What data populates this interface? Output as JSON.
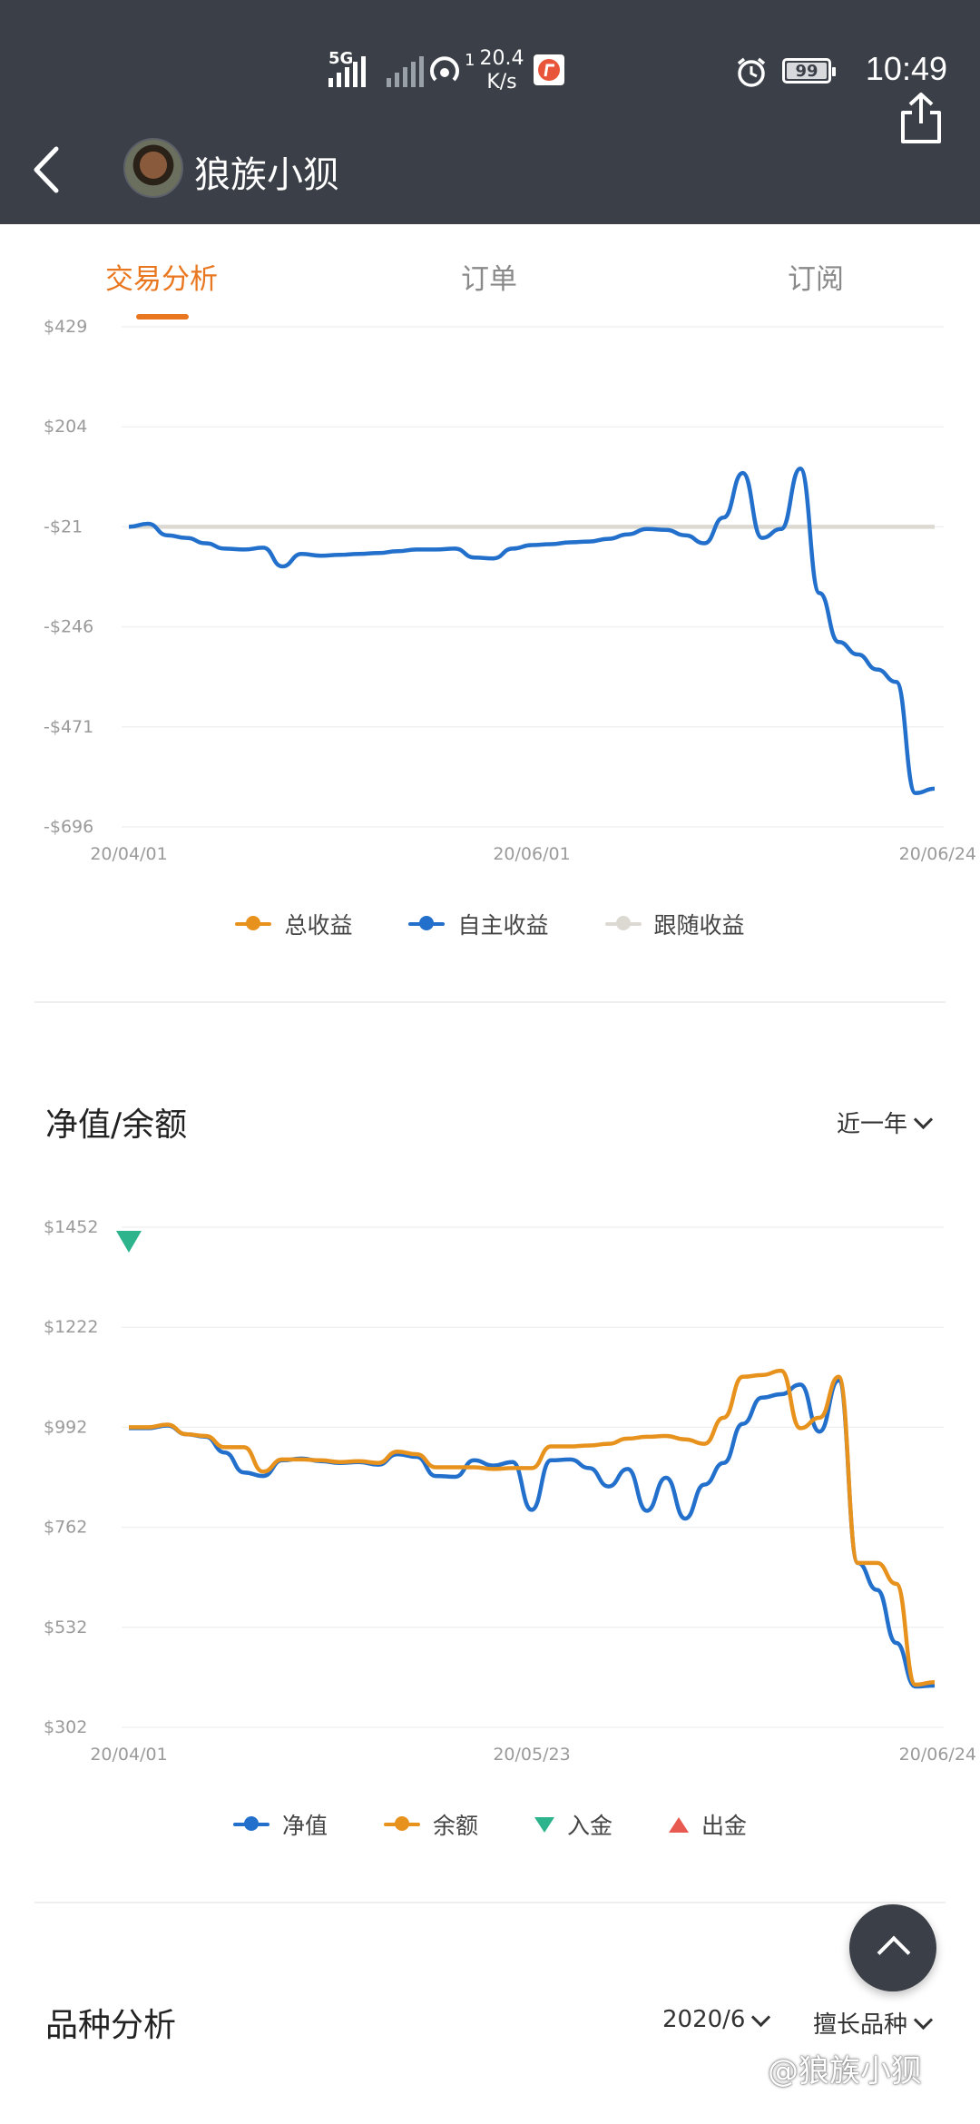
{
  "status_bar": {
    "network": "5G",
    "speed_value": "20.4",
    "speed_unit": "K/s",
    "hotspot_badge": "1",
    "battery": "99",
    "time": "10:49"
  },
  "header": {
    "username": "狼族小狈",
    "icons": [
      "back-arrow-icon",
      "avatar",
      "share-icon"
    ]
  },
  "tabs": [
    {
      "label": "交易分析",
      "active": true
    },
    {
      "label": "订单",
      "active": false
    },
    {
      "label": "订阅",
      "active": false
    }
  ],
  "colors": {
    "header_bg": "#3b3f47",
    "accent": "#e9771f",
    "blue": "#2270cc",
    "orange": "#e8921e",
    "grey": "#dcd9d2",
    "teal": "#2db48c",
    "red": "#e85a4f"
  },
  "chart_data": [
    {
      "type": "line",
      "ylim": [
        -696,
        429
      ],
      "yticks": [
        "$429",
        "$204",
        "-$21",
        "-$246",
        "-$471",
        "-$696"
      ],
      "xticks": [
        "20/04/01",
        "20/06/01",
        "20/06/24"
      ],
      "x": [
        "2020-04-01",
        "2020-04-03",
        "2020-04-05",
        "2020-04-07",
        "2020-04-09",
        "2020-04-11",
        "2020-04-13",
        "2020-04-15",
        "2020-04-17",
        "2020-04-19",
        "2020-04-21",
        "2020-04-23",
        "2020-04-25",
        "2020-04-27",
        "2020-04-29",
        "2020-05-01",
        "2020-05-03",
        "2020-05-05",
        "2020-05-07",
        "2020-05-09",
        "2020-05-11",
        "2020-05-13",
        "2020-05-15",
        "2020-05-17",
        "2020-05-19",
        "2020-05-21",
        "2020-05-23",
        "2020-05-25",
        "2020-05-27",
        "2020-05-29",
        "2020-05-31",
        "2020-06-02",
        "2020-06-04",
        "2020-06-06",
        "2020-06-08",
        "2020-06-10",
        "2020-06-12",
        "2020-06-14",
        "2020-06-16",
        "2020-06-18",
        "2020-06-20",
        "2020-06-22",
        "2020-06-24"
      ],
      "series": [
        {
          "name": "总收益",
          "color": "#e8921e",
          "values": []
        },
        {
          "name": "自主收益",
          "color": "#2270cc",
          "values": [
            -21,
            -14,
            -40,
            -46,
            -58,
            -70,
            -72,
            -68,
            -110,
            -82,
            -86,
            -84,
            -82,
            -80,
            -76,
            -72,
            -72,
            -70,
            -90,
            -92,
            -70,
            -62,
            -60,
            -56,
            -54,
            -48,
            -38,
            -26,
            -28,
            -40,
            -58,
            0,
            100,
            -46,
            -26,
            110,
            -170,
            -280,
            -308,
            -342,
            -370,
            -620,
            -610
          ]
        },
        {
          "name": "跟随收益",
          "color": "#dcd9d2",
          "values": [
            -21,
            -21,
            -21,
            -21,
            -21,
            -21,
            -21,
            -21,
            -21,
            -21,
            -21,
            -21,
            -21,
            -21,
            -21,
            -21,
            -21,
            -21,
            -21,
            -21,
            -21,
            -21,
            -21,
            -21,
            -21,
            -21,
            -21,
            -21,
            -21,
            -21,
            -21,
            -21,
            -21,
            -21,
            -21,
            -21,
            -21,
            -21,
            -21,
            -21,
            -21,
            -21,
            -21
          ]
        }
      ]
    },
    {
      "type": "line",
      "ylim": [
        302,
        1452
      ],
      "yticks": [
        "$1452",
        "$1222",
        "$992",
        "$762",
        "$532",
        "$302"
      ],
      "xticks": [
        "20/04/01",
        "20/05/23",
        "20/06/24"
      ],
      "x": [
        "2020-04-01",
        "2020-04-03",
        "2020-04-05",
        "2020-04-07",
        "2020-04-09",
        "2020-04-11",
        "2020-04-13",
        "2020-04-15",
        "2020-04-17",
        "2020-04-19",
        "2020-04-21",
        "2020-04-23",
        "2020-04-25",
        "2020-04-27",
        "2020-04-29",
        "2020-05-01",
        "2020-05-03",
        "2020-05-05",
        "2020-05-07",
        "2020-05-09",
        "2020-05-11",
        "2020-05-13",
        "2020-05-15",
        "2020-05-17",
        "2020-05-19",
        "2020-05-21",
        "2020-05-23",
        "2020-05-25",
        "2020-05-27",
        "2020-05-29",
        "2020-05-31",
        "2020-06-02",
        "2020-06-04",
        "2020-06-06",
        "2020-06-08",
        "2020-06-10",
        "2020-06-12",
        "2020-06-14",
        "2020-06-16",
        "2020-06-18",
        "2020-06-20",
        "2020-06-22",
        "2020-06-24"
      ],
      "series": [
        {
          "name": "净值",
          "color": "#2270cc",
          "values": [
            990,
            990,
            996,
            976,
            970,
            934,
            888,
            880,
            916,
            920,
            914,
            910,
            912,
            906,
            930,
            924,
            880,
            878,
            916,
            904,
            912,
            802,
            916,
            918,
            898,
            856,
            896,
            800,
            876,
            782,
            860,
            910,
            1000,
            1060,
            1068,
            1090,
            982,
            1100,
            680,
            618,
            496,
            396,
            398
          ]
        },
        {
          "name": "余额",
          "color": "#e8921e",
          "values": [
            992,
            992,
            998,
            976,
            972,
            946,
            946,
            890,
            918,
            918,
            916,
            912,
            914,
            910,
            936,
            930,
            900,
            900,
            900,
            896,
            898,
            898,
            948,
            948,
            950,
            954,
            966,
            970,
            972,
            964,
            954,
            1014,
            1108,
            1112,
            1122,
            990,
            1014,
            1108,
            680,
            680,
            632,
            400,
            406
          ]
        },
        {
          "name": "入金",
          "color": "#2db48c",
          "marker": "triangle-down",
          "points": [
            {
              "x": "2020-04-01",
              "y": 1452
            }
          ]
        },
        {
          "name": "出金",
          "color": "#e85a4f",
          "marker": "triangle-up",
          "points": []
        }
      ]
    }
  ],
  "legend1": [
    {
      "label": "总收益",
      "color": "#e8921e"
    },
    {
      "label": "自主收益",
      "color": "#2270cc"
    },
    {
      "label": "跟随收益",
      "color": "#dcd9d2"
    }
  ],
  "section_net": {
    "title": "净值/余额",
    "range_select": "近一年"
  },
  "legend2": [
    {
      "label": "净值",
      "color": "#2270cc",
      "kind": "dot"
    },
    {
      "label": "余额",
      "color": "#e8921e",
      "kind": "dot"
    },
    {
      "label": "入金",
      "color": "#2db48c",
      "kind": "tri-down"
    },
    {
      "label": "出金",
      "color": "#e85a4f",
      "kind": "tri-up"
    }
  ],
  "section_symbols": {
    "title": "品种分析",
    "month_select": "2020/6",
    "filter_select": "擅长品种"
  },
  "watermark": "@狼族小狈"
}
